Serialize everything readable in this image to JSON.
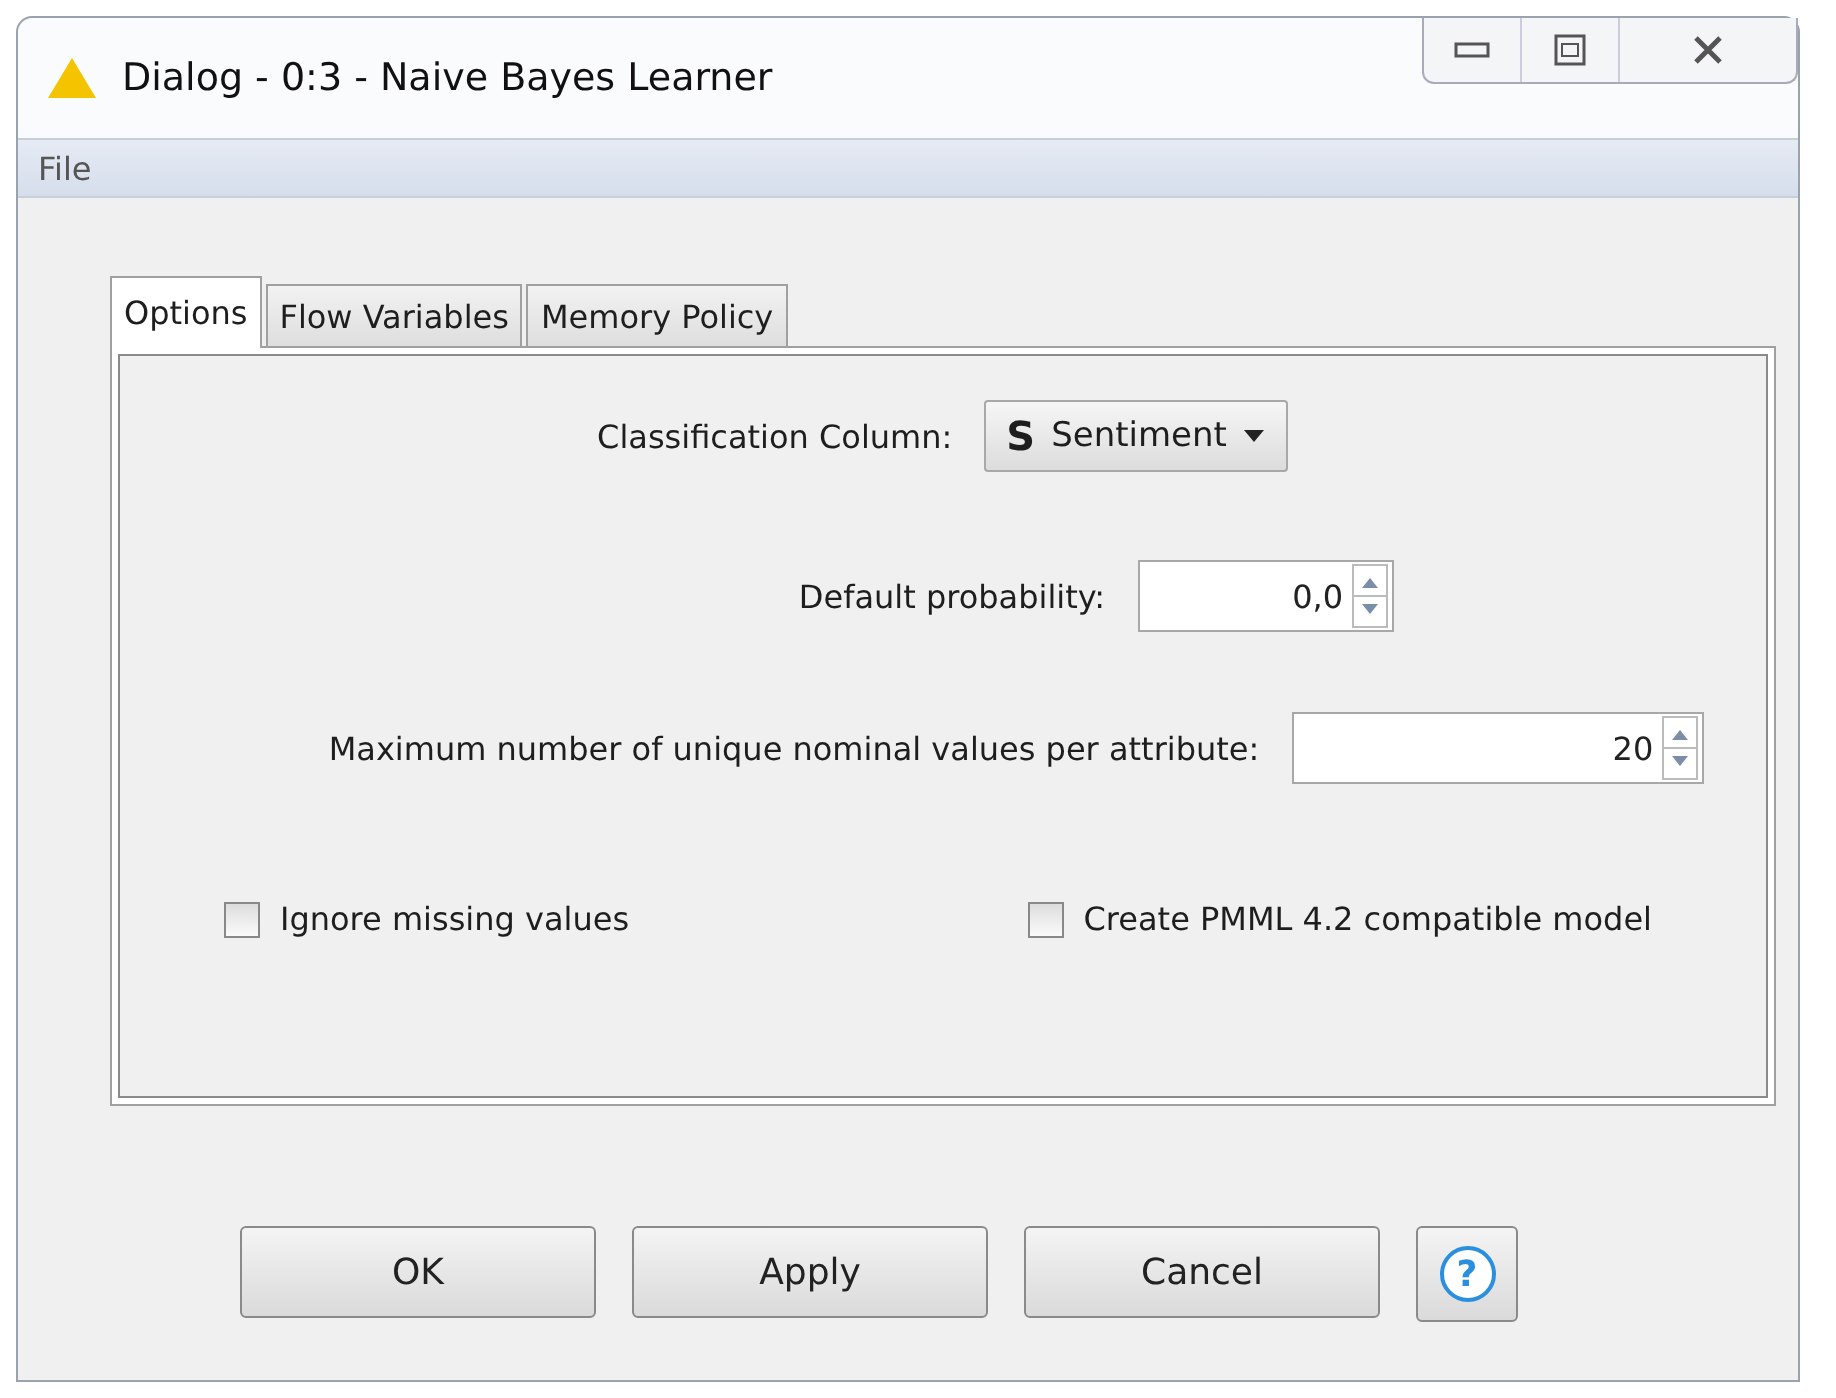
{
  "window": {
    "title": "Dialog - 0:3 - Naive Bayes Learner"
  },
  "menu": [
    "File"
  ],
  "tabs": [
    {
      "label": "Options",
      "selected": true
    },
    {
      "label": "Flow Variables",
      "selected": false
    },
    {
      "label": "Memory Policy",
      "selected": false
    }
  ],
  "classification_column": {
    "label": "Classification Column:",
    "type_badge": "S",
    "value": "Sentiment"
  },
  "default_probability": {
    "label": "Default probability:",
    "value": "0,0"
  },
  "max_nominal_values": {
    "label": "Maximum number of unique nominal values per attribute:",
    "value": "20"
  },
  "checkboxes": [
    {
      "label": "Ignore missing values",
      "checked": false
    },
    {
      "label": "Create PMML 4.2 compatible model",
      "checked": false
    }
  ],
  "buttons": [
    "OK",
    "Apply",
    "Cancel"
  ],
  "help_button": {
    "label": "?"
  }
}
